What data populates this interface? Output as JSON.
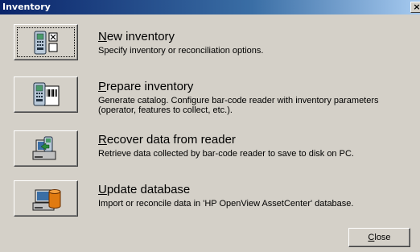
{
  "window": {
    "title": "Inventory",
    "close_glyph": "×"
  },
  "items": [
    {
      "title_first": "N",
      "title_rest": "ew inventory",
      "description": "Specify inventory or reconciliation options.",
      "icon": "barcode-reader-checklist-icon"
    },
    {
      "title_first": "P",
      "title_rest": "repare inventory",
      "description": "Generate catalog. Configure bar-code reader with inventory parameters (operator, features to collect, etc.).",
      "icon": "barcode-reader-document-icon"
    },
    {
      "title_first": "R",
      "title_rest": "ecover data from reader",
      "description": "Retrieve data collected by bar-code reader to save to disk on PC.",
      "icon": "reader-to-computer-icon"
    },
    {
      "title_first": "U",
      "title_rest": "pdate database",
      "description": "Import or reconcile data in 'HP OpenView AssetCenter' database.",
      "icon": "computer-database-icon"
    }
  ],
  "footer": {
    "close_first": "C",
    "close_rest": "lose"
  },
  "colors": {
    "face": "#d4d0c8",
    "title_start": "#0a246a",
    "title_end": "#a6caf0",
    "database_orange": "#e07a10"
  }
}
